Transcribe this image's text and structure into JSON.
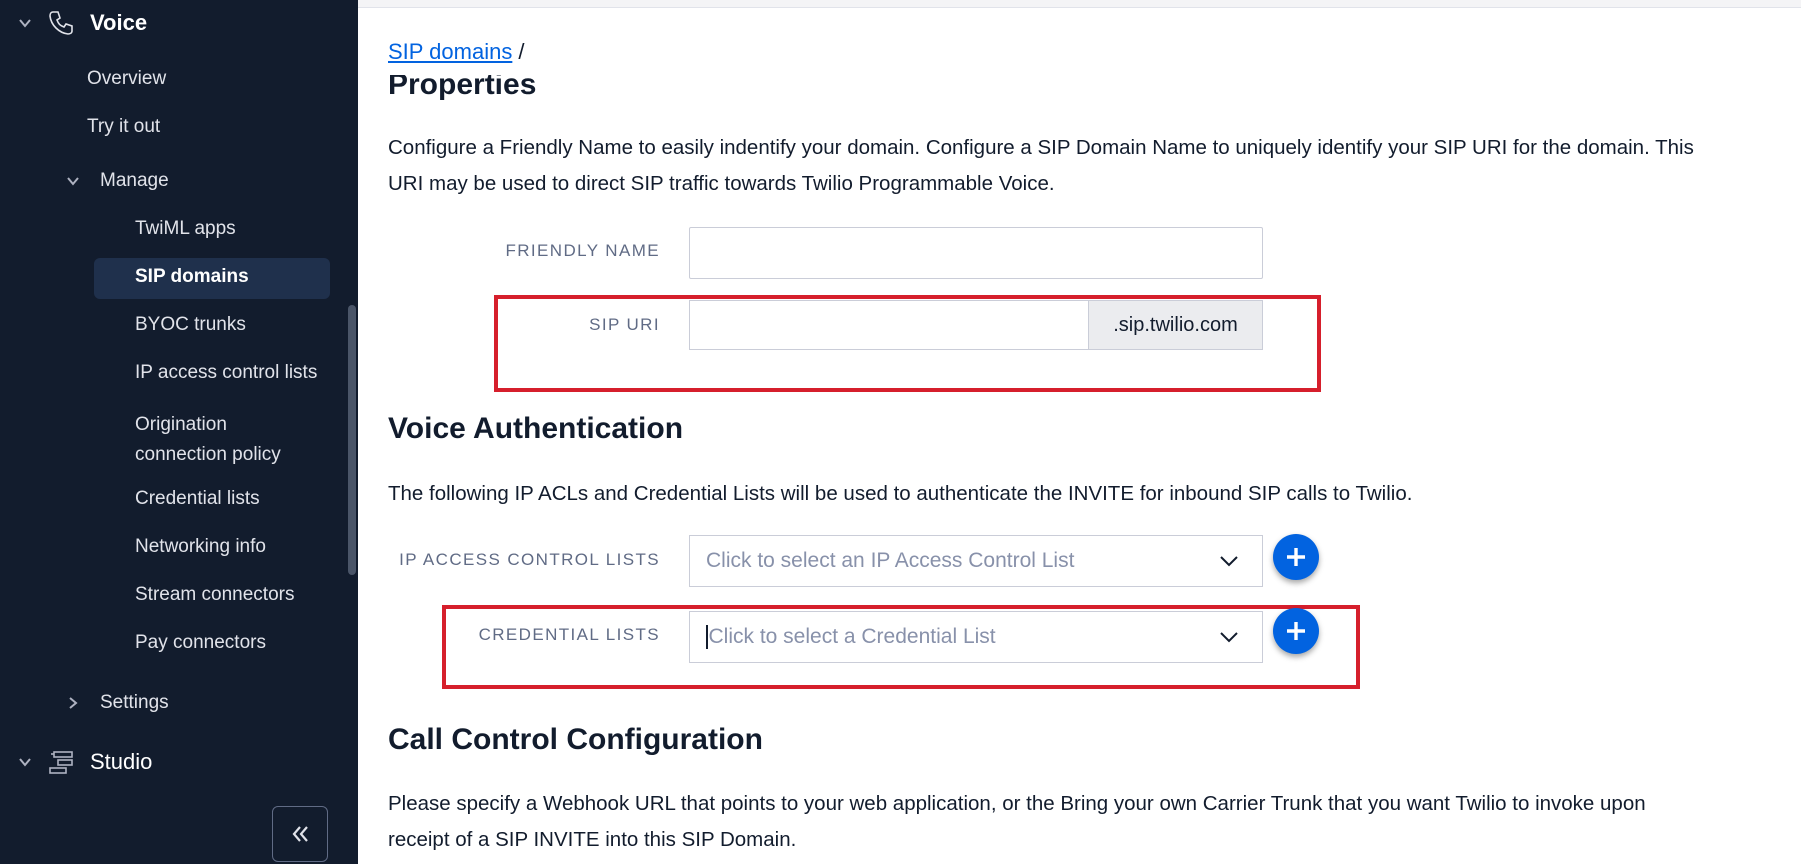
{
  "sidebar": {
    "voice_label": "Voice",
    "items": {
      "overview": "Overview",
      "try_it_out": "Try it out",
      "manage": "Manage",
      "twiml_apps": "TwiML apps",
      "sip_domains": "SIP domains",
      "byoc_trunks": "BYOC trunks",
      "ip_access_control_lists": "IP access control lists",
      "origination_line1": "Origination",
      "origination_line2": "connection policy",
      "credential_lists": "Credential lists",
      "networking_info": "Networking info",
      "stream_connectors": "Stream connectors",
      "pay_connectors": "Pay connectors",
      "settings": "Settings"
    },
    "studio_label": "Studio",
    "icons": [
      "chevron-down-icon",
      "phone-icon",
      "chevron-right-icon",
      "studio-icon",
      "double-chevron-left-icon"
    ]
  },
  "breadcrumb": {
    "link": "SIP domains",
    "separator": "/"
  },
  "properties": {
    "heading": "Properties",
    "description_line1": "Configure a Friendly Name to easily indentify your domain. Configure a SIP Domain Name to uniquely identify your SIP URI for the domain. This",
    "description_line2": "URI may be used to direct SIP traffic towards Twilio Programmable Voice.",
    "friendly_name_label": "FRIENDLY NAME",
    "friendly_name_value": "",
    "sip_uri_label": "SIP URI",
    "sip_uri_value": "",
    "sip_uri_suffix": ".sip.twilio.com"
  },
  "voice_auth": {
    "heading": "Voice Authentication",
    "description": "The following IP ACLs and Credential Lists will be used to authenticate the INVITE for inbound SIP calls to Twilio.",
    "ip_acl_label": "IP ACCESS CONTROL LISTS",
    "ip_acl_placeholder": "Click to select an IP Access Control List",
    "credential_label": "CREDENTIAL LISTS",
    "credential_placeholder": "Click to select a Credential List"
  },
  "call_control": {
    "heading": "Call Control Configuration",
    "description_line1": "Please specify a Webhook URL that points to your web application, or the Bring your own Carrier Trunk that you want Twilio to invoke upon",
    "description_line2": "receipt of a SIP INVITE into this SIP Domain."
  },
  "colors": {
    "sidebar_bg": "#121c2d",
    "active_item_bg": "#1f304c",
    "link": "#0263e0",
    "highlight": "#d61f2c",
    "plus_button": "#0263e0"
  }
}
